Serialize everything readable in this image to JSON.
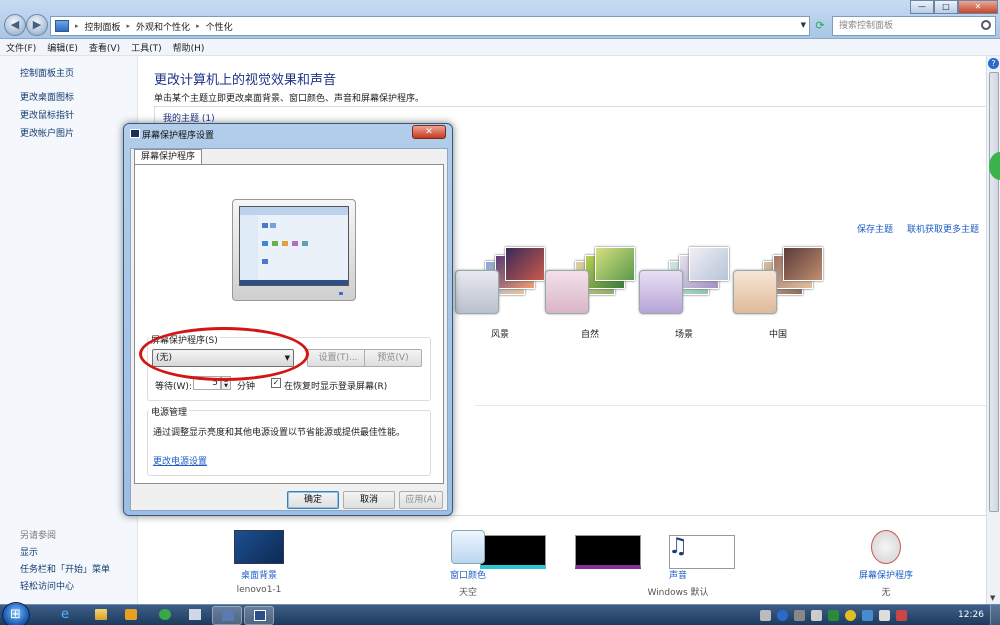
{
  "titlebar": {
    "breadcrumbs": [
      "控制面板",
      "外观和个性化",
      "个性化"
    ],
    "search_placeholder": "搜索控制面板",
    "win_btns": {
      "minimize": "—",
      "maximize": "□",
      "close": "✕"
    }
  },
  "menu": [
    "文件(F)",
    "编辑(E)",
    "查看(V)",
    "工具(T)",
    "帮助(H)"
  ],
  "leftpane": {
    "home": "控制面板主页",
    "links": [
      "更改桌面图标",
      "更改鼠标指针",
      "更改帐户图片"
    ],
    "see_also_title": "另请参阅",
    "see_also": [
      "显示",
      "任务栏和「开始」菜单",
      "轻松访问中心"
    ]
  },
  "main": {
    "title": "更改计算机上的视觉效果和声音",
    "subtitle": "单击某个主题立即更改桌面背景、窗口颜色、声音和屏幕保护程序。",
    "my_themes": "我的主题 (1)",
    "save_theme": "保存主题",
    "online_themes": "联机获取更多主题",
    "themes": [
      "风景",
      "自然",
      "场景",
      "中国"
    ]
  },
  "bottom": [
    {
      "label": "桌面背景",
      "sub": "lenovo1-1"
    },
    {
      "label": "窗口颜色",
      "sub": "天空"
    },
    {
      "label": "声音",
      "sub": "Windows 默认"
    },
    {
      "label": "屏幕保护程序",
      "sub": "无"
    }
  ],
  "dialog": {
    "title": "屏幕保护程序设置",
    "tab": "屏幕保护程序",
    "saver_group": "屏幕保护程序(S)",
    "saver_value": "(无)",
    "settings_btn": "设置(T)...",
    "preview_btn": "预览(V)",
    "wait_label": "等待(W):",
    "wait_value": "5",
    "wait_unit": "分钟",
    "resume_label": "在恢复时显示登录屏幕(R)",
    "resume_checked": true,
    "power_group": "电源管理",
    "power_desc": "通过调整显示亮度和其他电源设置以节省能源或提供最佳性能。",
    "power_link": "更改电源设置",
    "ok": "确定",
    "cancel": "取消",
    "apply": "应用(A)"
  },
  "taskbar": {
    "clock": "12:26"
  },
  "colors": {
    "link": "#1c5ec5",
    "title": "#1e3287",
    "highlight_ellipse": "#d21616"
  }
}
